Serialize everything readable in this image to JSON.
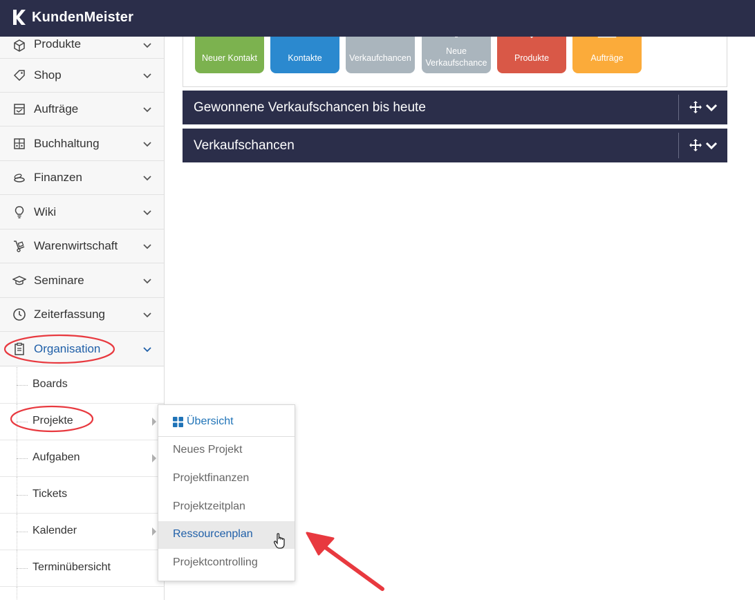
{
  "app": {
    "name": "KundenMeister"
  },
  "sidebar": {
    "items": [
      {
        "label": "Produkte",
        "icon": "box-icon"
      },
      {
        "label": "Shop",
        "icon": "tag-icon"
      },
      {
        "label": "Aufträge",
        "icon": "order-icon"
      },
      {
        "label": "Buchhaltung",
        "icon": "calculator-icon"
      },
      {
        "label": "Finanzen",
        "icon": "coins-icon"
      },
      {
        "label": "Wiki",
        "icon": "lightbulb-icon"
      },
      {
        "label": "Warenwirtschaft",
        "icon": "handtruck-icon"
      },
      {
        "label": "Seminare",
        "icon": "graduation-cap-icon"
      },
      {
        "label": "Zeiterfassung",
        "icon": "clock-icon"
      },
      {
        "label": "Organisation",
        "icon": "clipboard-icon",
        "active": true
      }
    ],
    "subitems": [
      {
        "label": "Boards",
        "has_submenu": false
      },
      {
        "label": "Projekte",
        "has_submenu": true
      },
      {
        "label": "Aufgaben",
        "has_submenu": true
      },
      {
        "label": "Tickets",
        "has_submenu": false
      },
      {
        "label": "Kalender",
        "has_submenu": true
      },
      {
        "label": "Terminübersicht",
        "has_submenu": false
      }
    ]
  },
  "tiles": [
    {
      "label": "Neuer Kontakt",
      "color": "#7cb24f"
    },
    {
      "label": "Kontakte",
      "color": "#2b89cf"
    },
    {
      "label": "Verkaufchancen",
      "color": "#aab5bd"
    },
    {
      "label": "Neue Verkaufschance",
      "color": "#aab5bd"
    },
    {
      "label": "Produkte",
      "color": "#d95847"
    },
    {
      "label": "Aufträge",
      "color": "#fbab3a"
    }
  ],
  "widgets": [
    {
      "title": "Gewonnene Verkaufschancen bis heute"
    },
    {
      "title": "Verkaufschancen"
    }
  ],
  "flyout": {
    "header": "Übersicht",
    "items": [
      {
        "label": "Neues Projekt"
      },
      {
        "label": "Projektfinanzen"
      },
      {
        "label": "Projektzeitplan"
      },
      {
        "label": "Ressourcenplan",
        "hover": true
      },
      {
        "label": "Projektcontrolling"
      }
    ]
  },
  "colors": {
    "topbar": "#2b2e4a",
    "accent": "#1f5fa8",
    "annotation": "#e8393f"
  }
}
